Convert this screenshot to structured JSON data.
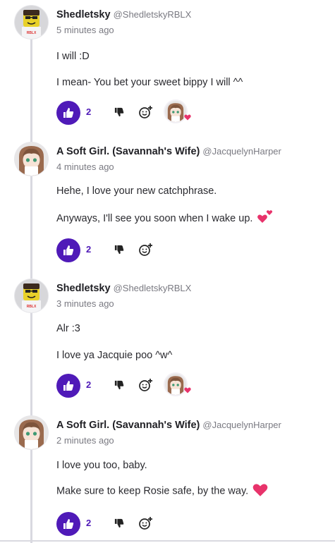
{
  "comments": [
    {
      "author": "Shedletsky",
      "handle": "@ShedletskyRBLX",
      "time": "5 minutes ago",
      "paragraphs": [
        "I will :D",
        "I mean- You bet your sweet bippy I will ^^"
      ],
      "likes": "2",
      "avatar_icon": "roblox-avatar-icon",
      "reaction": "heart-reaction-icon"
    },
    {
      "author": "A Soft Girl. (Savannah's Wife)",
      "handle": "@JacquelynHarper",
      "time": "4 minutes ago",
      "paragraphs": [
        "Hehe, I love your new catchphrase.",
        "Anyways, I'll see you soon when I wake up."
      ],
      "emoji": "two-hearts-emoji",
      "likes": "2",
      "avatar_icon": "anime-girl-avatar-icon"
    },
    {
      "author": "Shedletsky",
      "handle": "@ShedletskyRBLX",
      "time": "3 minutes ago",
      "paragraphs": [
        "Alr :3",
        "I love ya Jacquie poo ^w^"
      ],
      "likes": "2",
      "avatar_icon": "roblox-avatar-icon",
      "reaction": "heart-reaction-icon"
    },
    {
      "author": "A Soft Girl. (Savannah's Wife)",
      "handle": "@JacquelynHarper",
      "time": "2 minutes ago",
      "paragraphs": [
        "I love you too, baby.",
        "Make sure to keep Rosie safe, by the way."
      ],
      "emoji": "heart-emoji",
      "likes": "2",
      "avatar_icon": "anime-girl-avatar-icon"
    }
  ],
  "colors": {
    "accent": "#4f1ab8",
    "heart": "#e8336b",
    "thread_line": "#d9d9e0"
  }
}
